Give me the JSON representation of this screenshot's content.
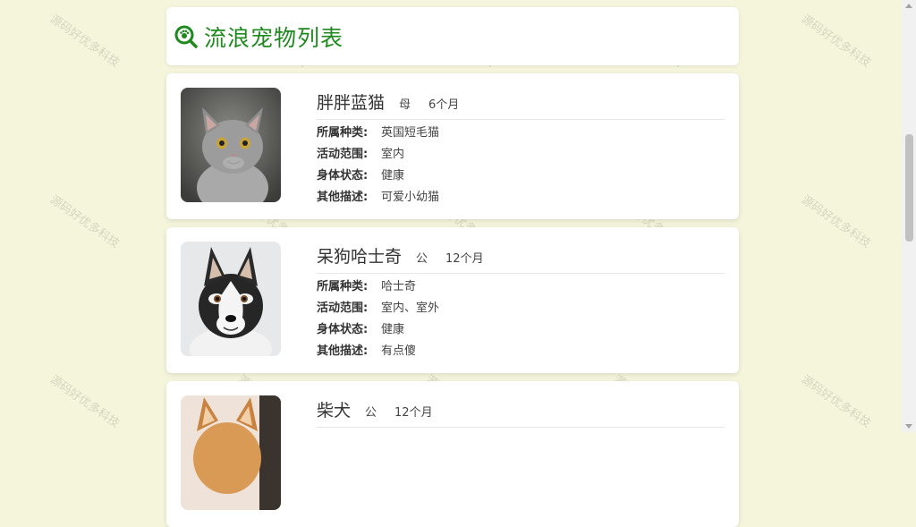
{
  "header": {
    "title": "流浪宠物列表",
    "icon": "search-pet-icon",
    "accent": "#1e8a1e"
  },
  "labels": {
    "species": "所属种类:",
    "range": "活动范围:",
    "health": "身体状态:",
    "desc": "其他描述:"
  },
  "pets": [
    {
      "name": "胖胖蓝猫",
      "gender": "母",
      "age": "6个月",
      "species": "英国短毛猫",
      "range": "室内",
      "health": "健康",
      "desc": "可爱小幼猫"
    },
    {
      "name": "呆狗哈士奇",
      "gender": "公",
      "age": "12个月",
      "species": "哈士奇",
      "range": "室内、室外",
      "health": "健康",
      "desc": "有点傻"
    },
    {
      "name": "柴犬",
      "gender": "公",
      "age": "12个月"
    }
  ],
  "watermark": "源码好优多科技"
}
